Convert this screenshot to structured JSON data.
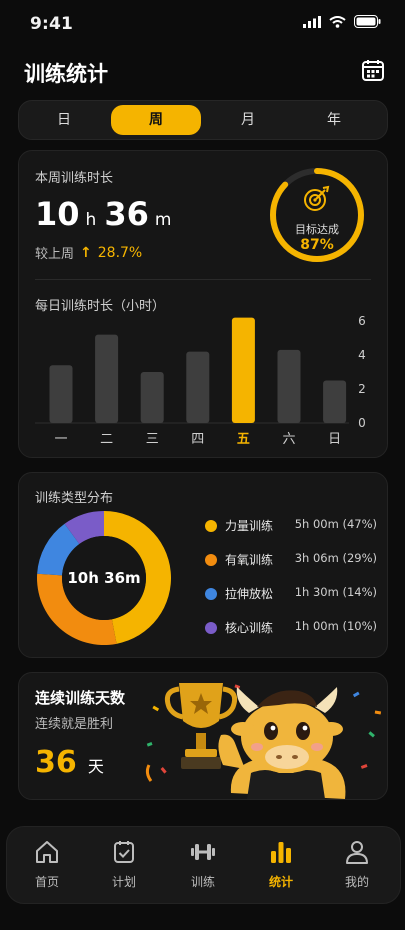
{
  "status": {
    "time": "9:41"
  },
  "header": {
    "title": "训练统计"
  },
  "tabs": [
    {
      "label": "日",
      "active": false
    },
    {
      "label": "周",
      "active": true
    },
    {
      "label": "月",
      "active": false
    },
    {
      "label": "年",
      "active": false
    }
  ],
  "weekly": {
    "label": "本周训练时长",
    "hours": "10",
    "hours_unit": "h",
    "minutes": "36",
    "minutes_unit": "m",
    "compare_label": "较上周",
    "compare_arrow": "↑",
    "compare_value": "28.7%",
    "goal_label": "目标达成",
    "goal_value": "87%",
    "goal_fraction": 0.87
  },
  "daily_title": "每日训练时长（小时）",
  "chart_data": {
    "type": "bar",
    "categories": [
      "一",
      "二",
      "三",
      "四",
      "五",
      "六",
      "日"
    ],
    "values": [
      3.4,
      5.2,
      3.0,
      4.2,
      6.2,
      4.3,
      2.5
    ],
    "highlight_index": 4,
    "yticks": [
      "0",
      "2",
      "4",
      "6"
    ],
    "ylim": [
      0,
      6
    ],
    "colors": {
      "bar": "#3e3e3e",
      "highlight": "#f5b400"
    }
  },
  "distribution": {
    "title": "训练类型分布",
    "center": "10h 36m",
    "items": [
      {
        "name": "力量训练",
        "value": "5h 00m (47%)",
        "pct": 47,
        "color": "#f5b400"
      },
      {
        "name": "有氧训练",
        "value": "3h 06m (29%)",
        "pct": 29,
        "color": "#f28c0f"
      },
      {
        "name": "拉伸放松",
        "value": "1h 30m (14%)",
        "pct": 14,
        "color": "#3f86e0"
      },
      {
        "name": "核心训练",
        "value": "1h 00m (10%)",
        "pct": 10,
        "color": "#7a5cc8"
      }
    ]
  },
  "streak": {
    "title": "连续训练天数",
    "subtitle": "连续就是胜利",
    "days": "36",
    "unit": "天"
  },
  "nav": [
    {
      "label": "首页",
      "icon": "home-icon",
      "active": false
    },
    {
      "label": "计划",
      "icon": "plan-icon",
      "active": false
    },
    {
      "label": "训练",
      "icon": "dumbbell-icon",
      "active": false
    },
    {
      "label": "统计",
      "icon": "stats-icon",
      "active": true
    },
    {
      "label": "我的",
      "icon": "profile-icon",
      "active": false
    }
  ]
}
